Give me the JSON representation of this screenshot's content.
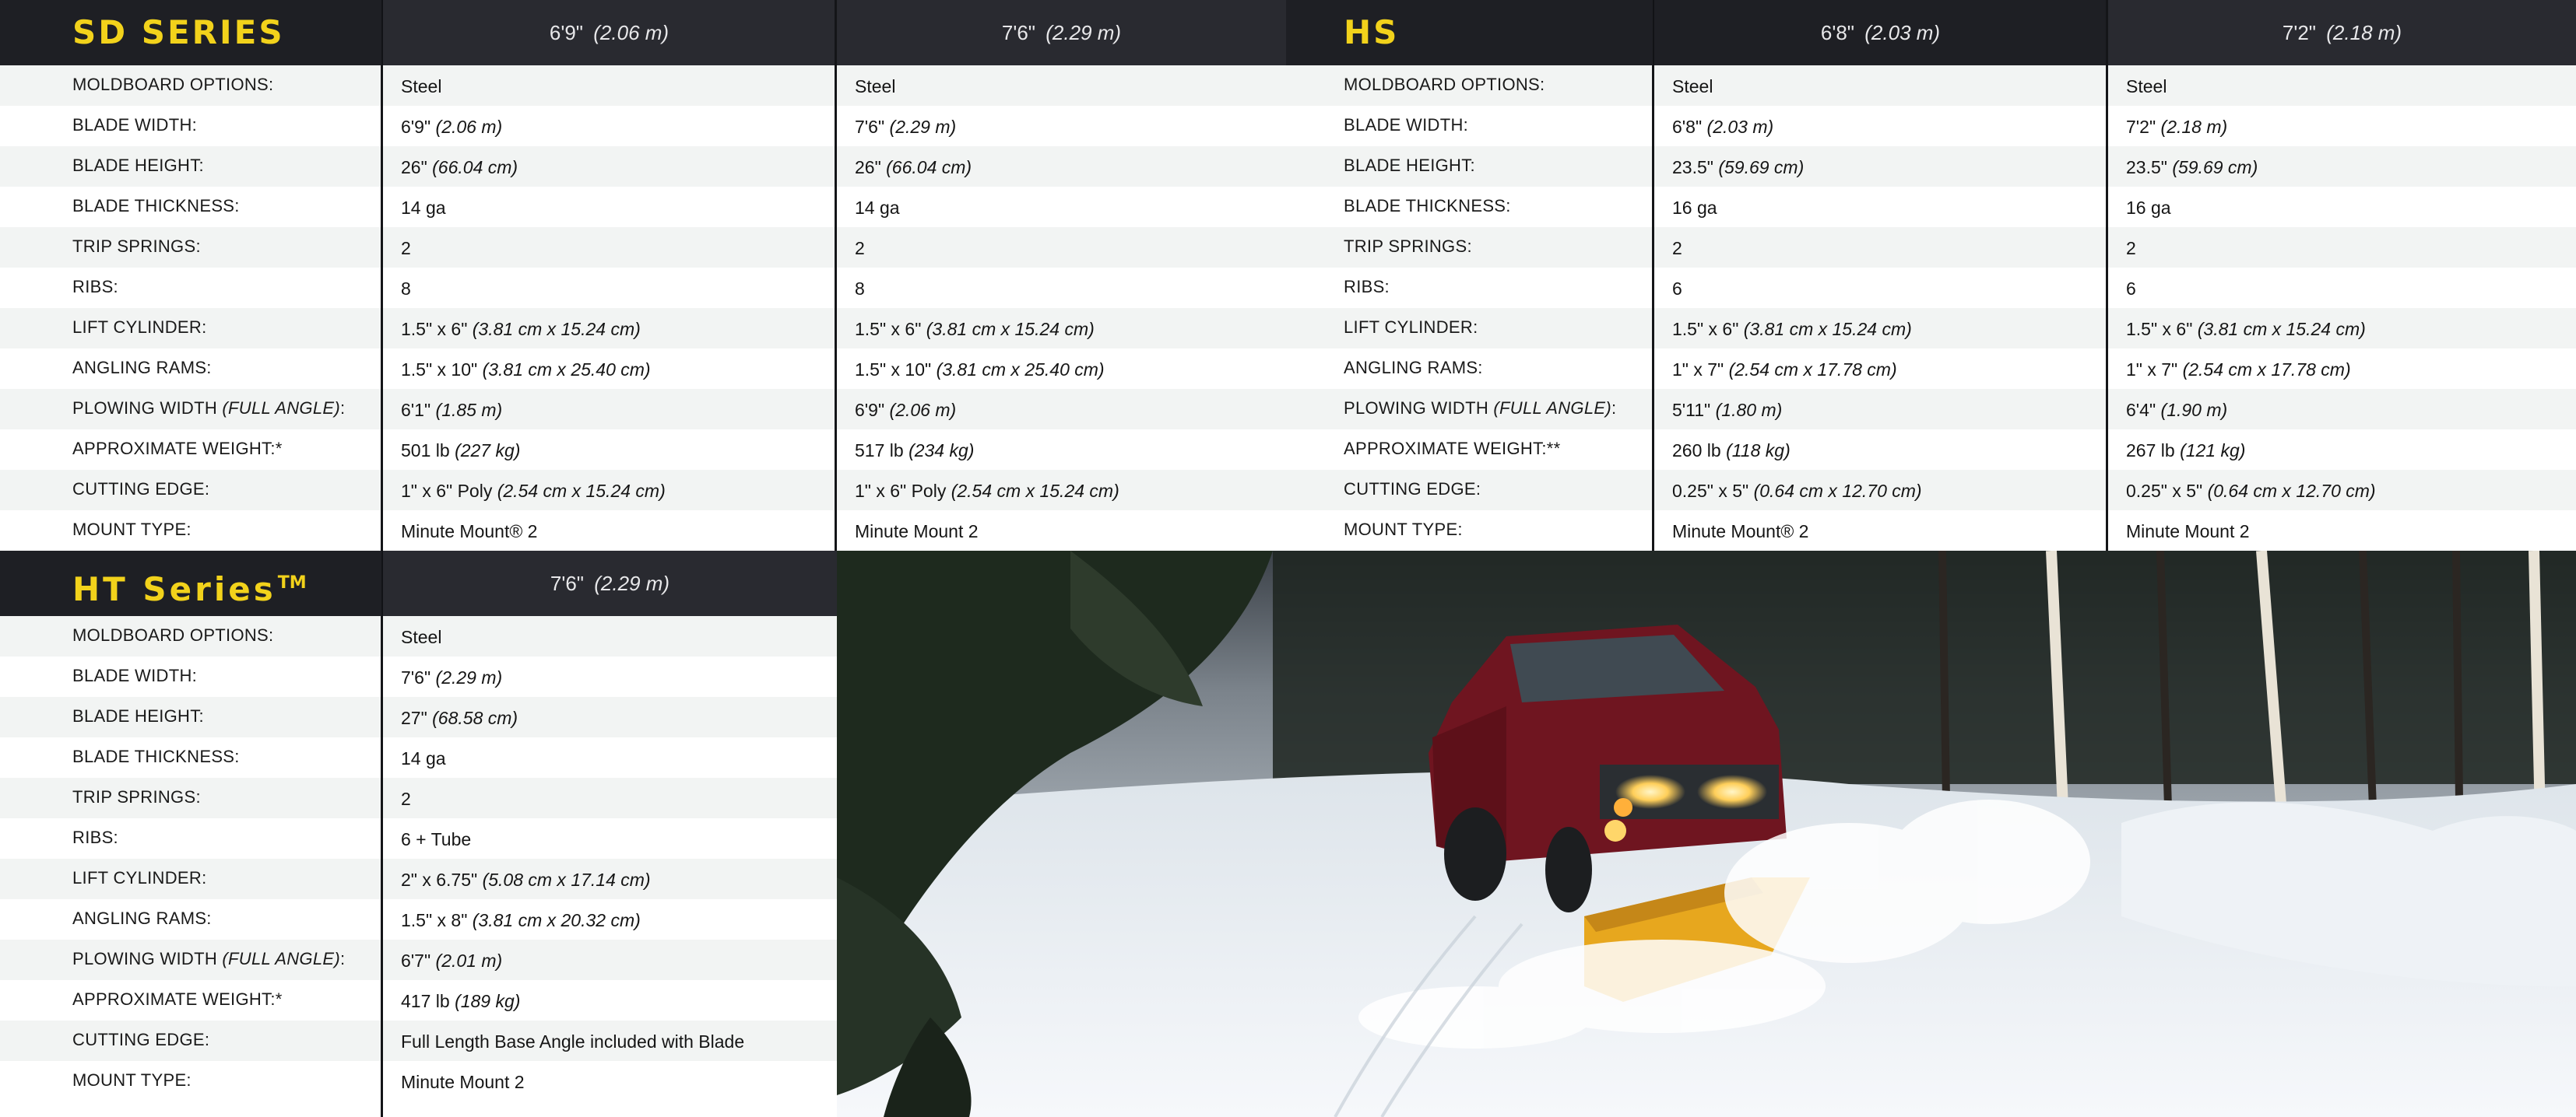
{
  "sd": {
    "title": "SD SERIES",
    "columns": [
      {
        "main": "6'9\"",
        "metric": "(2.06 m)"
      },
      {
        "main": "7'6\"",
        "metric": "(2.29 m)"
      }
    ],
    "rows": [
      {
        "label": "MOLDBOARD OPTIONS:",
        "label_italic": "",
        "label_suffix": "",
        "values": [
          {
            "main": "Steel",
            "metric": ""
          },
          {
            "main": "Steel",
            "metric": ""
          }
        ]
      },
      {
        "label": "BLADE WIDTH:",
        "label_italic": "",
        "label_suffix": "",
        "values": [
          {
            "main": "6'9\"",
            "metric": "(2.06 m)"
          },
          {
            "main": "7'6\"",
            "metric": "(2.29 m)"
          }
        ]
      },
      {
        "label": "BLADE HEIGHT:",
        "label_italic": "",
        "label_suffix": "",
        "values": [
          {
            "main": "26\"",
            "metric": "(66.04 cm)"
          },
          {
            "main": "26\"",
            "metric": "(66.04 cm)"
          }
        ]
      },
      {
        "label": "BLADE THICKNESS:",
        "label_italic": "",
        "label_suffix": "",
        "values": [
          {
            "main": "14 ga",
            "metric": ""
          },
          {
            "main": "14 ga",
            "metric": ""
          }
        ]
      },
      {
        "label": "TRIP SPRINGS:",
        "label_italic": "",
        "label_suffix": "",
        "values": [
          {
            "main": "2",
            "metric": ""
          },
          {
            "main": "2",
            "metric": ""
          }
        ]
      },
      {
        "label": "RIBS:",
        "label_italic": "",
        "label_suffix": "",
        "values": [
          {
            "main": "8",
            "metric": ""
          },
          {
            "main": "8",
            "metric": ""
          }
        ]
      },
      {
        "label": "LIFT CYLINDER:",
        "label_italic": "",
        "label_suffix": "",
        "values": [
          {
            "main": "1.5\" x 6\"",
            "metric": "(3.81 cm x 15.24 cm)"
          },
          {
            "main": "1.5\" x 6\"",
            "metric": "(3.81 cm x 15.24 cm)"
          }
        ]
      },
      {
        "label": "ANGLING RAMS:",
        "label_italic": "",
        "label_suffix": "",
        "values": [
          {
            "main": "1.5\" x 10\"",
            "metric": "(3.81 cm x 25.40 cm)"
          },
          {
            "main": "1.5\" x 10\"",
            "metric": "(3.81 cm x 25.40 cm)"
          }
        ]
      },
      {
        "label": "PLOWING WIDTH ",
        "label_italic": "(FULL ANGLE)",
        "label_suffix": ":",
        "values": [
          {
            "main": "6'1\"",
            "metric": "(1.85 m)"
          },
          {
            "main": "6'9\"",
            "metric": "(2.06 m)"
          }
        ]
      },
      {
        "label": "APPROXIMATE WEIGHT:*",
        "label_italic": "",
        "label_suffix": "",
        "values": [
          {
            "main": "501 lb",
            "metric": "(227 kg)"
          },
          {
            "main": "517 lb",
            "metric": "(234 kg)"
          }
        ]
      },
      {
        "label": "CUTTING EDGE:",
        "label_italic": "",
        "label_suffix": "",
        "values": [
          {
            "main": "1\" x 6\" Poly",
            "metric": "(2.54 cm x 15.24 cm)"
          },
          {
            "main": "1\" x 6\" Poly",
            "metric": "(2.54 cm x 15.24 cm)"
          }
        ]
      },
      {
        "label": "MOUNT TYPE:",
        "label_italic": "",
        "label_suffix": "",
        "values": [
          {
            "main": "Minute Mount® 2",
            "metric": ""
          },
          {
            "main": "Minute Mount 2",
            "metric": ""
          }
        ]
      }
    ]
  },
  "hs": {
    "title": "HS",
    "columns": [
      {
        "main": "6'8\"",
        "metric": "(2.03 m)"
      },
      {
        "main": "7'2\"",
        "metric": "(2.18 m)"
      }
    ],
    "rows": [
      {
        "label": "MOLDBOARD OPTIONS:",
        "label_italic": "",
        "label_suffix": "",
        "values": [
          {
            "main": "Steel",
            "metric": ""
          },
          {
            "main": "Steel",
            "metric": ""
          }
        ]
      },
      {
        "label": "BLADE WIDTH:",
        "label_italic": "",
        "label_suffix": "",
        "values": [
          {
            "main": "6'8\"",
            "metric": "(2.03 m)"
          },
          {
            "main": "7'2\"",
            "metric": "(2.18 m)"
          }
        ]
      },
      {
        "label": "BLADE HEIGHT:",
        "label_italic": "",
        "label_suffix": "",
        "values": [
          {
            "main": "23.5\"",
            "metric": "(59.69 cm)"
          },
          {
            "main": "23.5\"",
            "metric": "(59.69 cm)"
          }
        ]
      },
      {
        "label": "BLADE THICKNESS:",
        "label_italic": "",
        "label_suffix": "",
        "values": [
          {
            "main": "16 ga",
            "metric": ""
          },
          {
            "main": "16 ga",
            "metric": ""
          }
        ]
      },
      {
        "label": "TRIP SPRINGS:",
        "label_italic": "",
        "label_suffix": "",
        "values": [
          {
            "main": "2",
            "metric": ""
          },
          {
            "main": "2",
            "metric": ""
          }
        ]
      },
      {
        "label": "RIBS:",
        "label_italic": "",
        "label_suffix": "",
        "values": [
          {
            "main": "6",
            "metric": ""
          },
          {
            "main": "6",
            "metric": ""
          }
        ]
      },
      {
        "label": "LIFT CYLINDER:",
        "label_italic": "",
        "label_suffix": "",
        "values": [
          {
            "main": "1.5\" x 6\"",
            "metric": "(3.81 cm x 15.24 cm)"
          },
          {
            "main": "1.5\" x 6\"",
            "metric": "(3.81 cm x 15.24 cm)"
          }
        ]
      },
      {
        "label": "ANGLING RAMS:",
        "label_italic": "",
        "label_suffix": "",
        "values": [
          {
            "main": "1\" x 7\"",
            "metric": "(2.54 cm x 17.78 cm)"
          },
          {
            "main": "1\" x 7\"",
            "metric": "(2.54 cm x 17.78 cm)"
          }
        ]
      },
      {
        "label": "PLOWING WIDTH ",
        "label_italic": "(FULL ANGLE)",
        "label_suffix": ":",
        "values": [
          {
            "main": "5'11\"",
            "metric": "(1.80 m)"
          },
          {
            "main": "6'4\"",
            "metric": "(1.90 m)"
          }
        ]
      },
      {
        "label": "APPROXIMATE WEIGHT:**",
        "label_italic": "",
        "label_suffix": "",
        "values": [
          {
            "main": "260 lb",
            "metric": "(118 kg)"
          },
          {
            "main": "267 lb",
            "metric": "(121 kg)"
          }
        ]
      },
      {
        "label": "CUTTING EDGE:",
        "label_italic": "",
        "label_suffix": "",
        "values": [
          {
            "main": "0.25\" x 5\"",
            "metric": "(0.64 cm x 12.70 cm)"
          },
          {
            "main": "0.25\" x 5\"",
            "metric": "(0.64 cm x 12.70 cm)"
          }
        ]
      },
      {
        "label": "MOUNT TYPE:",
        "label_italic": "",
        "label_suffix": "",
        "values": [
          {
            "main": "Minute Mount® 2",
            "metric": ""
          },
          {
            "main": "Minute Mount 2",
            "metric": ""
          }
        ]
      }
    ]
  },
  "ht": {
    "title": "HT Series",
    "title_mark": "TM",
    "columns": [
      {
        "main": "7'6\"",
        "metric": "(2.29 m)"
      }
    ],
    "rows": [
      {
        "label": "MOLDBOARD OPTIONS:",
        "label_italic": "",
        "label_suffix": "",
        "values": [
          {
            "main": "Steel",
            "metric": ""
          }
        ]
      },
      {
        "label": "BLADE WIDTH:",
        "label_italic": "",
        "label_suffix": "",
        "values": [
          {
            "main": "7'6\"",
            "metric": "(2.29 m)"
          }
        ]
      },
      {
        "label": "BLADE HEIGHT:",
        "label_italic": "",
        "label_suffix": "",
        "values": [
          {
            "main": "27\"",
            "metric": "(68.58 cm)"
          }
        ]
      },
      {
        "label": "BLADE THICKNESS:",
        "label_italic": "",
        "label_suffix": "",
        "values": [
          {
            "main": "14 ga",
            "metric": ""
          }
        ]
      },
      {
        "label": "TRIP SPRINGS:",
        "label_italic": "",
        "label_suffix": "",
        "values": [
          {
            "main": "2",
            "metric": ""
          }
        ]
      },
      {
        "label": "RIBS:",
        "label_italic": "",
        "label_suffix": "",
        "values": [
          {
            "main": "6 + Tube",
            "metric": ""
          }
        ]
      },
      {
        "label": "LIFT CYLINDER:",
        "label_italic": "",
        "label_suffix": "",
        "values": [
          {
            "main": "2\" x 6.75\"",
            "metric": "(5.08 cm x 17.14 cm)"
          }
        ]
      },
      {
        "label": "ANGLING RAMS:",
        "label_italic": "",
        "label_suffix": "",
        "values": [
          {
            "main": "1.5\" x 8\"",
            "metric": "(3.81 cm x 20.32 cm)"
          }
        ]
      },
      {
        "label": "PLOWING WIDTH ",
        "label_italic": "(FULL ANGLE)",
        "label_suffix": ":",
        "values": [
          {
            "main": "6'7\"",
            "metric": "(2.01 m)"
          }
        ]
      },
      {
        "label": "APPROXIMATE WEIGHT:*",
        "label_italic": "",
        "label_suffix": "",
        "values": [
          {
            "main": "417 lb",
            "metric": "(189 kg)"
          }
        ]
      },
      {
        "label": "CUTTING EDGE:",
        "label_italic": "",
        "label_suffix": "",
        "values": [
          {
            "main": "Full Length Base Angle included with Blade",
            "metric": ""
          }
        ]
      },
      {
        "label": "MOUNT TYPE:",
        "label_italic": "",
        "label_suffix": "",
        "values": [
          {
            "main": "Minute Mount 2",
            "metric": ""
          }
        ]
      }
    ]
  },
  "colors": {
    "header_bg": "#1e1f24",
    "title_yellow": "#f2d21b",
    "plow_blade": "#e7a71e",
    "truck_red": "#7a1420"
  },
  "photo": {
    "subject_icons": [
      "pickup-truck-icon",
      "snowplow-blade-icon",
      "pine-tree-icon",
      "snow-spray-icon"
    ]
  }
}
